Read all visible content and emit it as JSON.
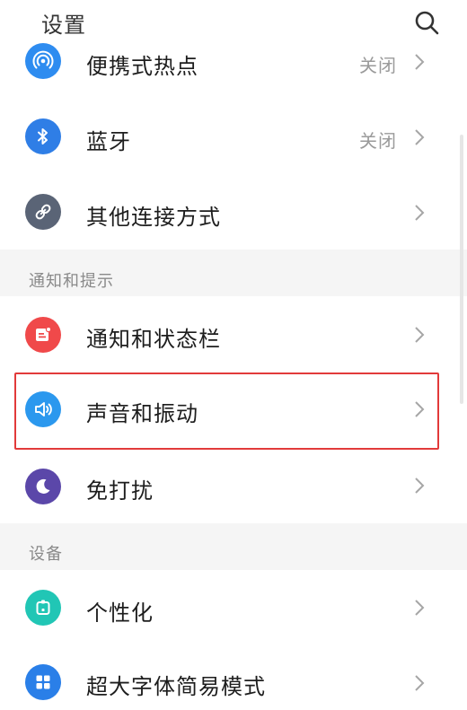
{
  "header": {
    "title": "设置",
    "search_icon": "search-icon"
  },
  "rows": {
    "hotspot": {
      "label": "便携式热点",
      "status": "关闭",
      "icon": "hotspot-icon",
      "color": "#2e8cf0"
    },
    "bluetooth": {
      "label": "蓝牙",
      "status": "关闭",
      "icon": "bluetooth-icon",
      "color": "#2f7ee6"
    },
    "other_connections": {
      "label": "其他连接方式",
      "icon": "link-icon",
      "color": "#5a6476"
    },
    "notifications": {
      "label": "通知和状态栏",
      "icon": "notification-icon",
      "color": "#f0494a"
    },
    "sound": {
      "label": "声音和振动",
      "icon": "speaker-icon",
      "color": "#2b98ee"
    },
    "dnd": {
      "label": "免打扰",
      "icon": "moon-icon",
      "color": "#5b47a9"
    },
    "personalize": {
      "label": "个性化",
      "icon": "personalize-icon",
      "color": "#21c6b5"
    },
    "large_font": {
      "label": "超大字体简易模式",
      "icon": "grid-icon",
      "color": "#2a7fe8"
    }
  },
  "sections": {
    "notify": "通知和提示",
    "device": "设备"
  },
  "highlight_color": "#e23a3a"
}
